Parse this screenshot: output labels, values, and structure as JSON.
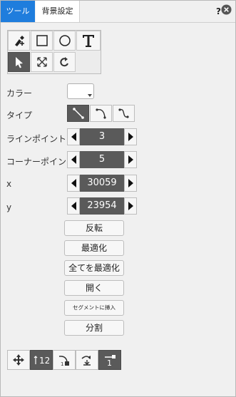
{
  "tabs": [
    {
      "label": "ツール",
      "active": true
    },
    {
      "label": "背景設定",
      "active": false
    }
  ],
  "header": {
    "help_label": "?"
  },
  "tools": [
    {
      "icon": "pen-add-icon",
      "selected": false
    },
    {
      "icon": "rectangle-icon",
      "selected": false
    },
    {
      "icon": "circle-icon",
      "selected": false
    },
    {
      "icon": "text-icon",
      "selected": false
    },
    {
      "icon": "select-arrow-icon",
      "selected": true
    },
    {
      "icon": "resize-icon",
      "selected": false
    },
    {
      "icon": "rotate-icon",
      "selected": false
    }
  ],
  "color": {
    "label": "カラー",
    "value": "#ffffff"
  },
  "type": {
    "label": "タイプ",
    "options": [
      "straight",
      "curve",
      "s-curve"
    ],
    "selected": 0
  },
  "line_points": {
    "label": "ラインポイント",
    "value": "3"
  },
  "corner_points": {
    "label": "コーナーポイント",
    "value": "5"
  },
  "x": {
    "label": "x",
    "value": "30059"
  },
  "y": {
    "label": "y",
    "value": "23954"
  },
  "actions": {
    "flip": "反転",
    "optimize": "最適化",
    "optimize_all": "全てを最適化",
    "open": "開く",
    "insert_segment": "セグメントに挿入",
    "split": "分割"
  },
  "bottom_tools": {
    "order_label": "12",
    "last_label": "1"
  },
  "colors": {
    "accent": "#1f7ddd",
    "selected": "#5a5a5a"
  }
}
